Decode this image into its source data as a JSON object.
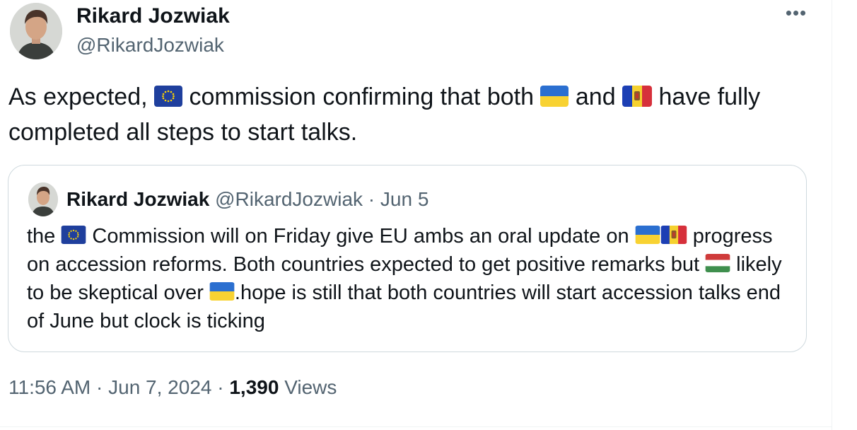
{
  "author": {
    "name": "Rikard Jozwiak",
    "handle": "@RikardJozwiak"
  },
  "more_label": "•••",
  "tweet": {
    "part1": "As expected, ",
    "part2": " commission confirming that both ",
    "part3": " and ",
    "part4": " have fully completed all steps to start talks."
  },
  "quote": {
    "name": "Rikard Jozwiak",
    "handle": "@RikardJozwiak",
    "sep": " · ",
    "date": "Jun 5",
    "part1": "the ",
    "part2": " Commission will on Friday give EU ambs an oral update on ",
    "part3": " progress on accession reforms. Both countries expected to get positive remarks but ",
    "part4": " likely to be skeptical over ",
    "part5": ".hope is still that both countries will start accession talks end of June but clock is ticking"
  },
  "meta": {
    "time": "11:56 AM",
    "sep1": " · ",
    "date": "Jun 7, 2024",
    "sep2": " · ",
    "views_count": "1,390",
    "views_label": " Views"
  },
  "icons": {
    "eu": "eu-flag-icon",
    "ukraine": "ukraine-flag-icon",
    "moldova": "moldova-flag-icon",
    "hungary": "hungary-flag-icon"
  },
  "colors": {
    "text": "#0f1419",
    "secondary": "#536471",
    "border": "#cfd9de"
  }
}
